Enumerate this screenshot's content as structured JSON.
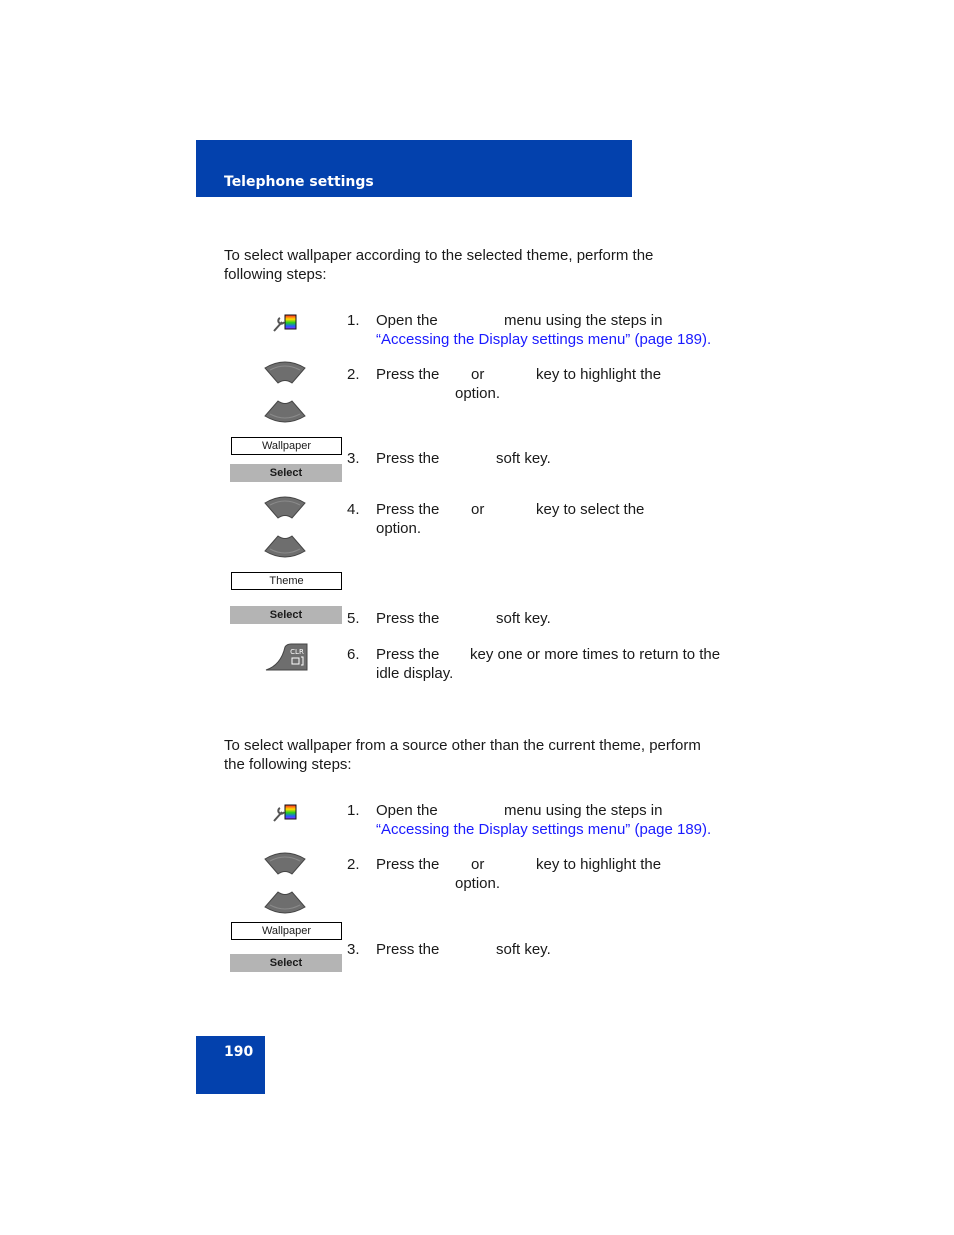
{
  "header": {
    "title": "Telephone settings",
    "color": "#0341ad"
  },
  "footer": {
    "page_number": "190"
  },
  "sections": [
    {
      "intro": [
        "To select wallpaper according to the selected theme, perform the",
        "following steps:"
      ],
      "steps": [
        {
          "num": "1.",
          "a": "Open the",
          "b": "menu using the steps in",
          "link": "“Accessing the Display settings menu” (page 189).",
          "icon": "display-settings-icon"
        },
        {
          "num": "2.",
          "a": "Press the",
          "b": "or",
          "c": "key to highlight the",
          "line2": "option.",
          "icon": "up-down-navigation-keys"
        },
        {
          "num": "3.",
          "a": "Press the",
          "b": "soft key.",
          "softkey_label": "Wallpaper",
          "softkey_button": "Select"
        },
        {
          "num": "4.",
          "a": "Press the",
          "b": "or",
          "c": "key to select the",
          "line2": "option.",
          "icon": "up-down-navigation-keys",
          "softkey_label": "Theme"
        },
        {
          "num": "5.",
          "a": "Press the",
          "b": "soft key.",
          "softkey_button": "Select"
        },
        {
          "num": "6.",
          "a": "Press the",
          "b": "key one or more times to return to the",
          "line2": "idle display.",
          "icon": "clear-key-icon"
        }
      ]
    },
    {
      "intro": [
        "To select wallpaper from a source other than the current theme, perform",
        "the following steps:"
      ],
      "steps": [
        {
          "num": "1.",
          "a": "Open the",
          "b": "menu using the steps in",
          "link": "“Accessing the Display settings menu” (page 189).",
          "icon": "display-settings-icon"
        },
        {
          "num": "2.",
          "a": "Press the",
          "b": "or",
          "c": "key to highlight the",
          "line2": "option.",
          "icon": "up-down-navigation-keys"
        },
        {
          "num": "3.",
          "a": "Press the",
          "b": "soft key.",
          "softkey_label": "Wallpaper",
          "softkey_button": "Select"
        }
      ]
    }
  ]
}
